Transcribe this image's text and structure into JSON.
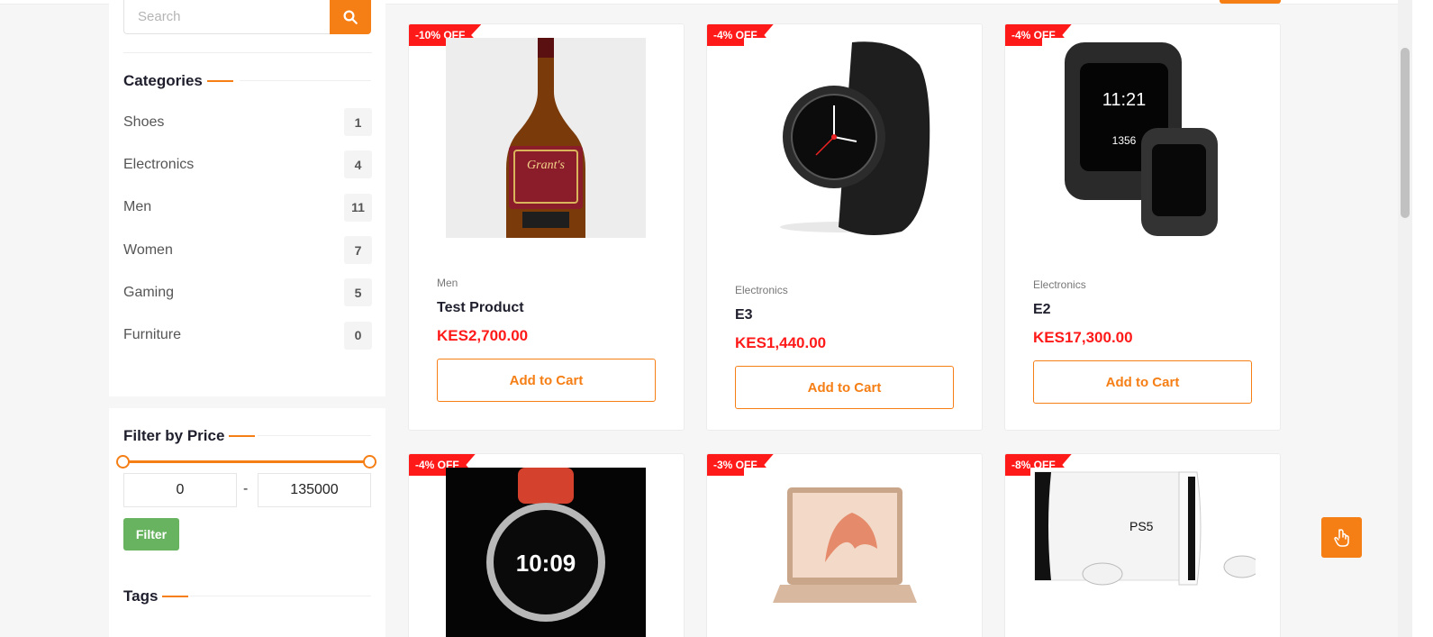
{
  "search": {
    "placeholder": "Search"
  },
  "categories": {
    "title": "Categories",
    "items": [
      {
        "label": "Shoes",
        "count": "1"
      },
      {
        "label": "Electronics",
        "count": "4"
      },
      {
        "label": "Men",
        "count": "11"
      },
      {
        "label": "Women",
        "count": "7"
      },
      {
        "label": "Gaming",
        "count": "5"
      },
      {
        "label": "Furniture",
        "count": "0"
      }
    ]
  },
  "price_filter": {
    "title": "Filter by Price",
    "min_value": "0",
    "max_value": "135000",
    "separator": "-",
    "button_label": "Filter"
  },
  "tags": {
    "title": "Tags"
  },
  "products": [
    {
      "badge": "-10% OFF",
      "category": "Men",
      "name": "Test Product",
      "price": "KES2,700.00",
      "button": "Add to Cart"
    },
    {
      "badge": "-4% OFF",
      "category": "Electronics",
      "name": "E3",
      "price": "KES1,440.00",
      "button": "Add to Cart"
    },
    {
      "badge": "-4% OFF",
      "category": "Electronics",
      "name": "E2",
      "price": "KES17,300.00",
      "button": "Add to Cart"
    },
    {
      "badge": "-4% OFF"
    },
    {
      "badge": "-3% OFF"
    },
    {
      "badge": "-8% OFF"
    }
  ],
  "colors": {
    "accent": "#f57e15",
    "sale": "#ff1a1a",
    "filter_button": "#68b35f"
  }
}
